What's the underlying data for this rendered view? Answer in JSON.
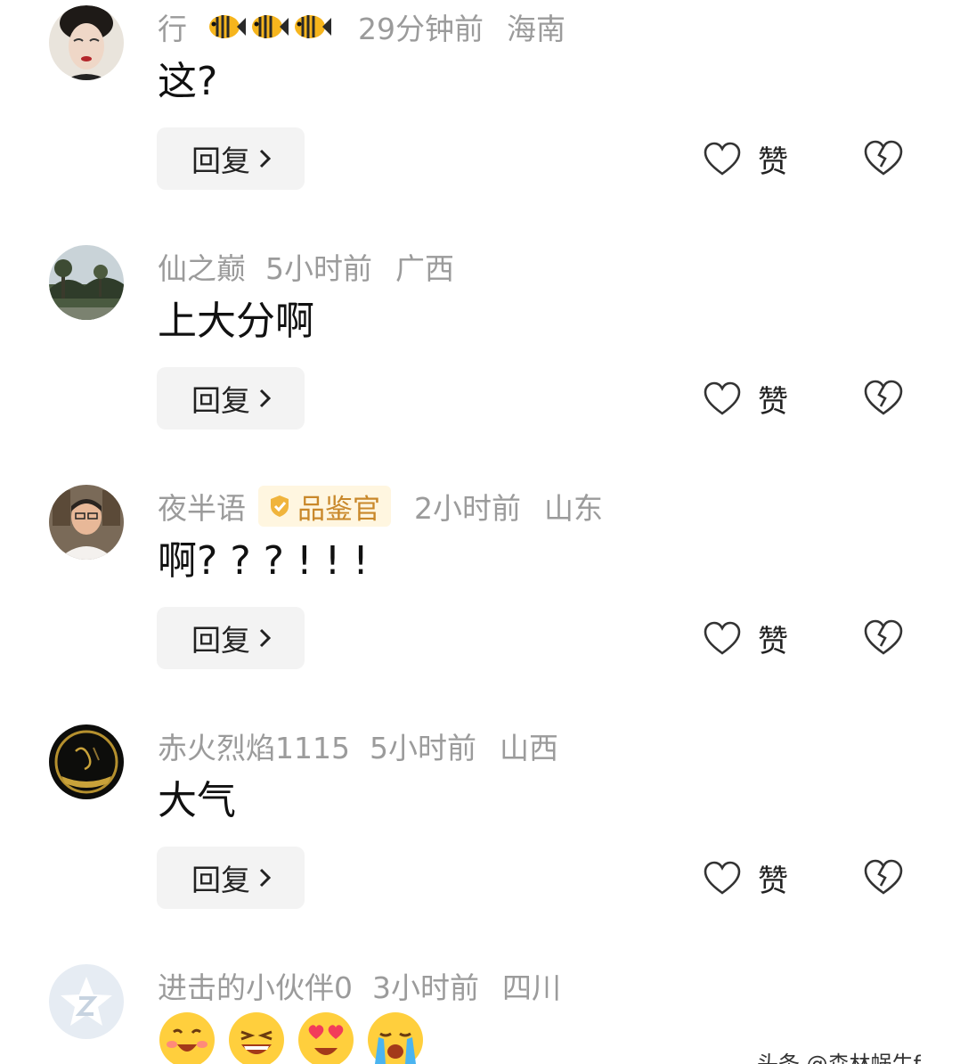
{
  "like_label": "赞",
  "reply_label": "回复",
  "comments": [
    {
      "name": "行",
      "time": "29分钟前",
      "location": "海南",
      "text": "这?",
      "fan_badges": [
        "fish-badge-icon",
        "fish-badge-icon",
        "fish-badge-icon"
      ]
    },
    {
      "name": "仙之巅",
      "time": "5小时前",
      "location": "广西",
      "text": "上大分啊"
    },
    {
      "name": "夜半语",
      "badge": "品鉴官",
      "time": "2小时前",
      "location": "山东",
      "text": "啊? ? ? ! ! !"
    },
    {
      "name": "赤火烈焰1115",
      "time": "5小时前",
      "location": "山西",
      "text": "大气"
    },
    {
      "name": "进击的小伙伴0",
      "time": "3小时前",
      "location": "四川",
      "emojis": [
        "shy-laugh-emoji",
        "grin-emoji",
        "heart-eyes-emoji",
        "crying-emoji"
      ]
    }
  ],
  "watermark": "头条 @森林蜗牛f",
  "colors": {
    "meta_text": "#9b9b9b",
    "badge_bg": "#fff6e0",
    "badge_text": "#c9882a",
    "reply_bg": "#f3f3f3"
  }
}
